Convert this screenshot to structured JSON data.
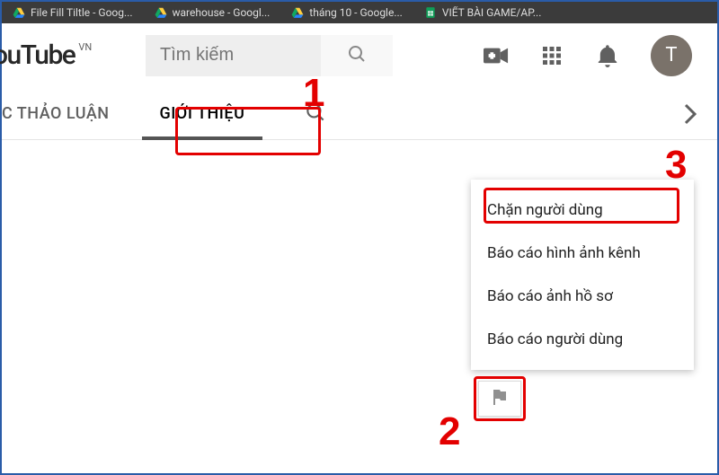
{
  "browser": {
    "tabs": [
      {
        "label": "File Fill Tiltle - Goog...",
        "kind": "drive"
      },
      {
        "label": "warehouse - Googl...",
        "kind": "drive"
      },
      {
        "label": "tháng 10 - Google...",
        "kind": "drive"
      },
      {
        "label": "VIẾT BÀI GAME/AP...",
        "kind": "sheets"
      }
    ]
  },
  "logo": {
    "brand": "ouTube",
    "country": "VN"
  },
  "search": {
    "placeholder": "Tìm kiếm"
  },
  "header": {
    "avatar_initial": "T"
  },
  "channel_tabs": {
    "discussion": "C THẢO LUẬN",
    "about": "GIỚI THIỆU"
  },
  "flag_menu": {
    "items": [
      "Chặn người dùng",
      "Báo cáo hình ảnh kênh",
      "Báo cáo ảnh hồ sơ",
      "Báo cáo người dùng"
    ]
  },
  "annotations": {
    "n1": "1",
    "n2": "2",
    "n3": "3"
  }
}
